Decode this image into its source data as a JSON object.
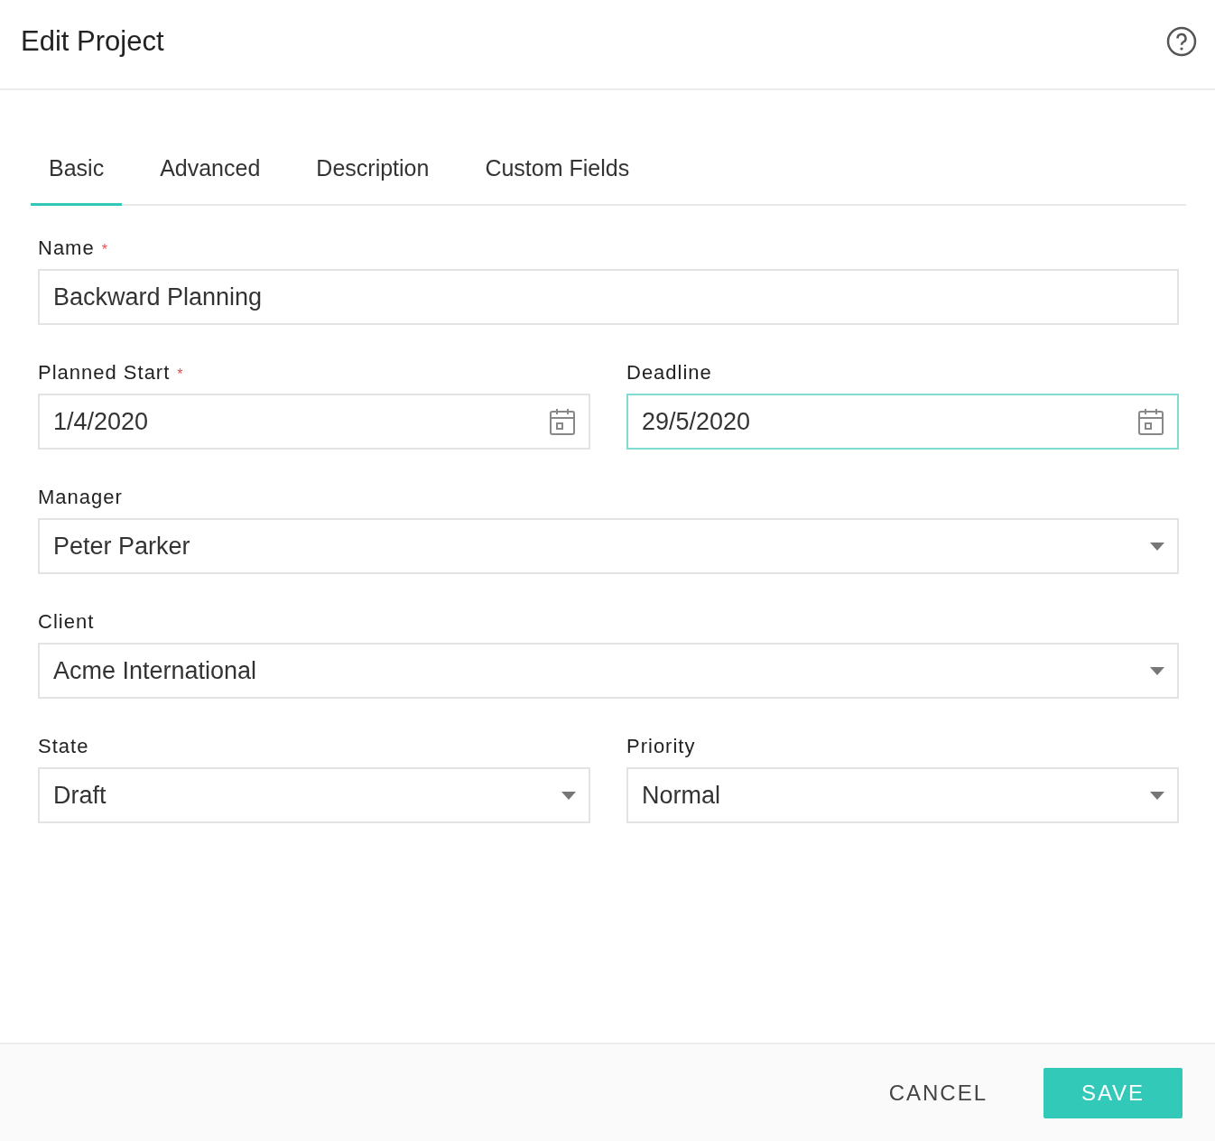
{
  "dialog": {
    "title": "Edit Project"
  },
  "tabs": [
    {
      "label": "Basic",
      "selected": true
    },
    {
      "label": "Advanced",
      "selected": false
    },
    {
      "label": "Description",
      "selected": false
    },
    {
      "label": "Custom Fields",
      "selected": false
    }
  ],
  "rows": [
    {
      "fields": [
        {
          "kind": "text",
          "label": "Name",
          "required_mark": "*",
          "value": "Backward Planning",
          "focused": false
        }
      ]
    },
    {
      "fields": [
        {
          "kind": "date",
          "label": "Planned Start",
          "required_mark": "*",
          "value": "1/4/2020",
          "focused": false
        },
        {
          "kind": "date",
          "label": "Deadline",
          "value": "29/5/2020",
          "focused": true
        }
      ]
    },
    {
      "fields": [
        {
          "kind": "select",
          "label": "Manager",
          "value": "Peter Parker",
          "focused": false
        }
      ]
    },
    {
      "fields": [
        {
          "kind": "select",
          "label": "Client",
          "value": "Acme International",
          "focused": false
        }
      ]
    },
    {
      "fields": [
        {
          "kind": "select",
          "label": "State",
          "value": "Draft",
          "focused": false
        },
        {
          "kind": "select",
          "label": "Priority",
          "value": "Normal",
          "focused": false
        }
      ]
    }
  ],
  "footer": {
    "cancel": "CANCEL",
    "save": "SAVE"
  }
}
